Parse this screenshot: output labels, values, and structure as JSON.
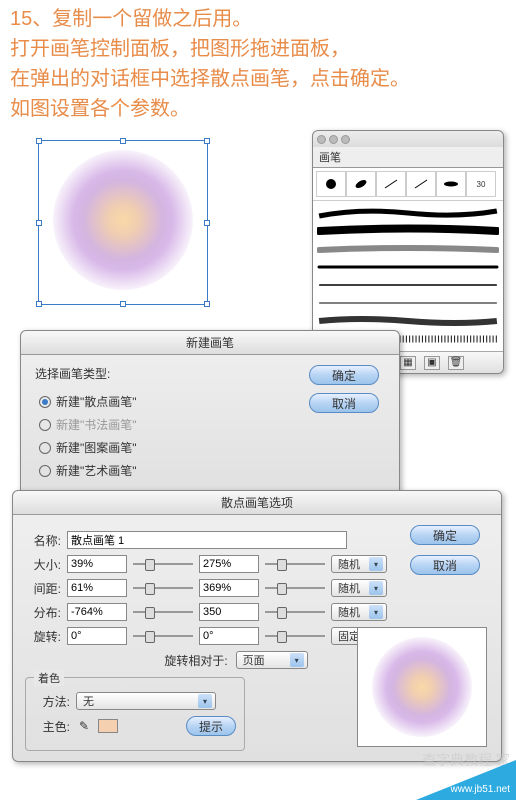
{
  "instructions": {
    "line1": "15、复制一个留做之后用。",
    "line2": "打开画笔控制面板，把图形拖进面板，",
    "line3": "在弹出的对话框中选择散点画笔，点击确定。",
    "line4": "如图设置各个参数。"
  },
  "brush_panel": {
    "tab": "画笔",
    "thumb_label": "30"
  },
  "new_brush": {
    "title": "新建画笔",
    "group_label": "选择画笔类型:",
    "options": [
      {
        "label": "新建\"散点画笔\"",
        "selected": true,
        "enabled": true
      },
      {
        "label": "新建\"书法画笔\"",
        "selected": false,
        "enabled": false
      },
      {
        "label": "新建\"图案画笔\"",
        "selected": false,
        "enabled": true
      },
      {
        "label": "新建\"艺术画笔\"",
        "selected": false,
        "enabled": true
      }
    ],
    "ok": "确定",
    "cancel": "取消"
  },
  "scatter": {
    "title": "散点画笔选项",
    "name_label": "名称:",
    "name_value": "散点画笔 1",
    "size_label": "大小:",
    "size_a": "39%",
    "size_b": "275%",
    "size_mode": "随机",
    "spacing_label": "间距:",
    "spacing_a": "61%",
    "spacing_b": "369%",
    "spacing_mode": "随机",
    "scatter_label": "分布:",
    "scatter_a": "-764%",
    "scatter_b": "350",
    "scatter_mode": "随机",
    "rotate_label": "旋转:",
    "rotate_a": "0°",
    "rotate_b": "0°",
    "rotate_mode": "固定",
    "rotate_rel_label": "旋转相对于:",
    "rotate_rel_value": "页面",
    "color_group": "着色",
    "method_label": "方法:",
    "method_value": "无",
    "main_color_label": "主色:",
    "tip_btn": "提示",
    "ok": "确定",
    "cancel": "取消"
  },
  "watermark": {
    "site": "www.jb51.net",
    "txt": "查字典教程 家"
  }
}
